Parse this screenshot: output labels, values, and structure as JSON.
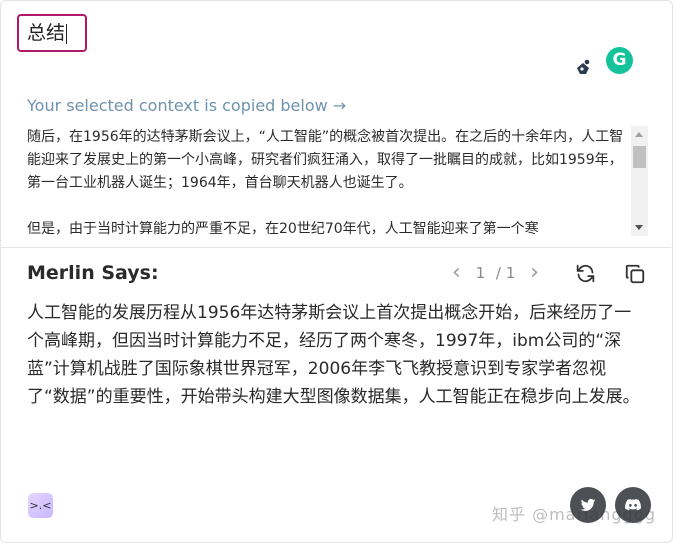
{
  "prompt": {
    "value": "总结"
  },
  "context": {
    "hint": "Your selected context is copied below →",
    "paragraphs": [
      "随后，在1956年的达特茅斯会议上，“人工智能”的概念被首次提出。在之后的十余年内，人工智能迎来了发展史上的第一个小高峰，研究者们疯狂涌入，取得了一批瞩目的成就，比如1959年，第一台工业机器人诞生；1964年，首台聊天机器人也诞生了。",
      "但是，由于当时计算能力的严重不足，在20世纪70年代，人工智能迎来了第一个寒"
    ]
  },
  "merlin": {
    "title": "Merlin Says:",
    "pager": {
      "current": "1",
      "total": "/ 1"
    },
    "answer": "人工智能的发展历程从1956年达特茅斯会议上首次提出概念开始，后来经历了一个高峰期，但因当时计算能力不足，经历了两个寒冬，1997年，ibm公司的“深蓝”计算机战胜了国际象棋世界冠军，2006年李飞飞教授意识到专家学者忽视了“数据”的重要性，开始带头构建大型图像数据集，人工智能正在稳步向上发展。"
  },
  "grammarly": {
    "letter": "G"
  },
  "emoji": {
    "text": ">.<"
  },
  "watermark": {
    "text": "知乎 @mariangggg"
  },
  "colors": {
    "accent_border": "#b0186c",
    "hint": "#6f93ad",
    "grammarly": "#15c39a"
  }
}
